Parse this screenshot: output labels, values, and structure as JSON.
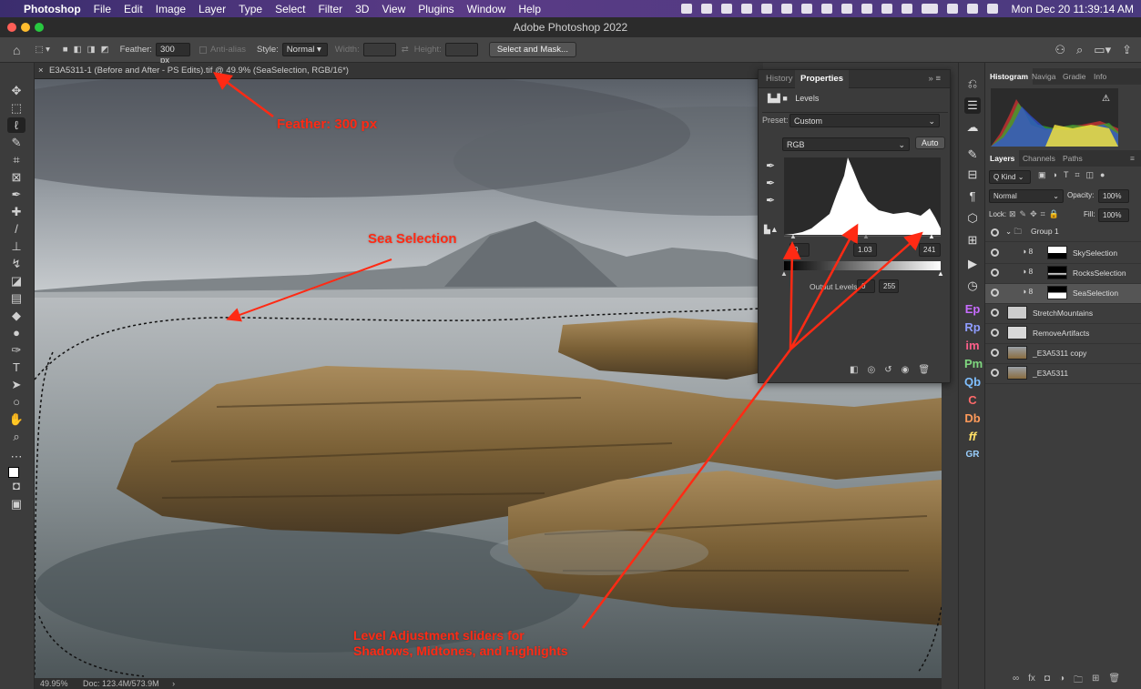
{
  "menubar": {
    "apple": "",
    "items": [
      "Photoshop",
      "File",
      "Edit",
      "Image",
      "Layer",
      "Type",
      "Select",
      "Filter",
      "3D",
      "View",
      "Plugins",
      "Window",
      "Help"
    ],
    "datetime": "Mon Dec 20  11:39:14 AM"
  },
  "window": {
    "title": "Adobe Photoshop 2022"
  },
  "options": {
    "feather_label": "Feather:",
    "feather_value": "300 px",
    "antialias_label": "Anti-alias",
    "style_label": "Style:",
    "style_value": "Normal",
    "width_label": "Width:",
    "height_label": "Height:",
    "select_mask": "Select and Mask..."
  },
  "document": {
    "tab_title": "E3A5311-1 (Before and After - PS Edits).tif @ 49.9% (SeaSelection, RGB/16*)",
    "zoom": "49.95%",
    "doc_size": "Doc: 123.4M/573.9M"
  },
  "annotations": {
    "feather": "Feather: 300 px",
    "sea": "Sea Selection",
    "levels_line1": "Level Adjustment sliders for",
    "levels_line2": "Shadows, Midtones, and Highlights"
  },
  "properties": {
    "tabs": [
      "History",
      "Properties"
    ],
    "active_tab": "Properties",
    "panel_title": "Levels",
    "preset_label": "Preset:",
    "preset_value": "Custom",
    "channel": "RGB",
    "auto": "Auto",
    "input_shadow": "0",
    "input_mid": "1.03",
    "input_high": "241",
    "output_label": "Output Levels:",
    "output_low": "0",
    "output_high": "255"
  },
  "histogram_panel": {
    "tabs": [
      "Histogram",
      "Naviga",
      "Gradie",
      "Info"
    ]
  },
  "layers_panel": {
    "tabs": [
      "Layers",
      "Channels",
      "Paths"
    ],
    "kind": "Q Kind",
    "blend": "Normal",
    "opacity_label": "Opacity:",
    "opacity": "100%",
    "lock_label": "Lock:",
    "fill_label": "Fill:",
    "fill": "100%",
    "layers": [
      {
        "name": "Group 1",
        "type": "group"
      },
      {
        "name": "SkySelection",
        "type": "adjustment"
      },
      {
        "name": "RocksSelection",
        "type": "adjustment"
      },
      {
        "name": "SeaSelection",
        "type": "adjustment",
        "selected": true
      },
      {
        "name": "StretchMountains",
        "type": "pixel"
      },
      {
        "name": "RemoveArtifacts",
        "type": "pixel"
      },
      {
        "name": "_E3A5311 copy",
        "type": "pixel"
      },
      {
        "name": "_E3A5311",
        "type": "pixel"
      }
    ]
  },
  "plugin_strip": [
    "Ep",
    "Rp",
    "im",
    "Pm",
    "Qb",
    "C",
    "Db",
    "ff",
    "GR"
  ],
  "colors": {
    "annotation": "#ff2a14",
    "panel": "#3b3b3b",
    "menubar": "#4a3a7e"
  }
}
